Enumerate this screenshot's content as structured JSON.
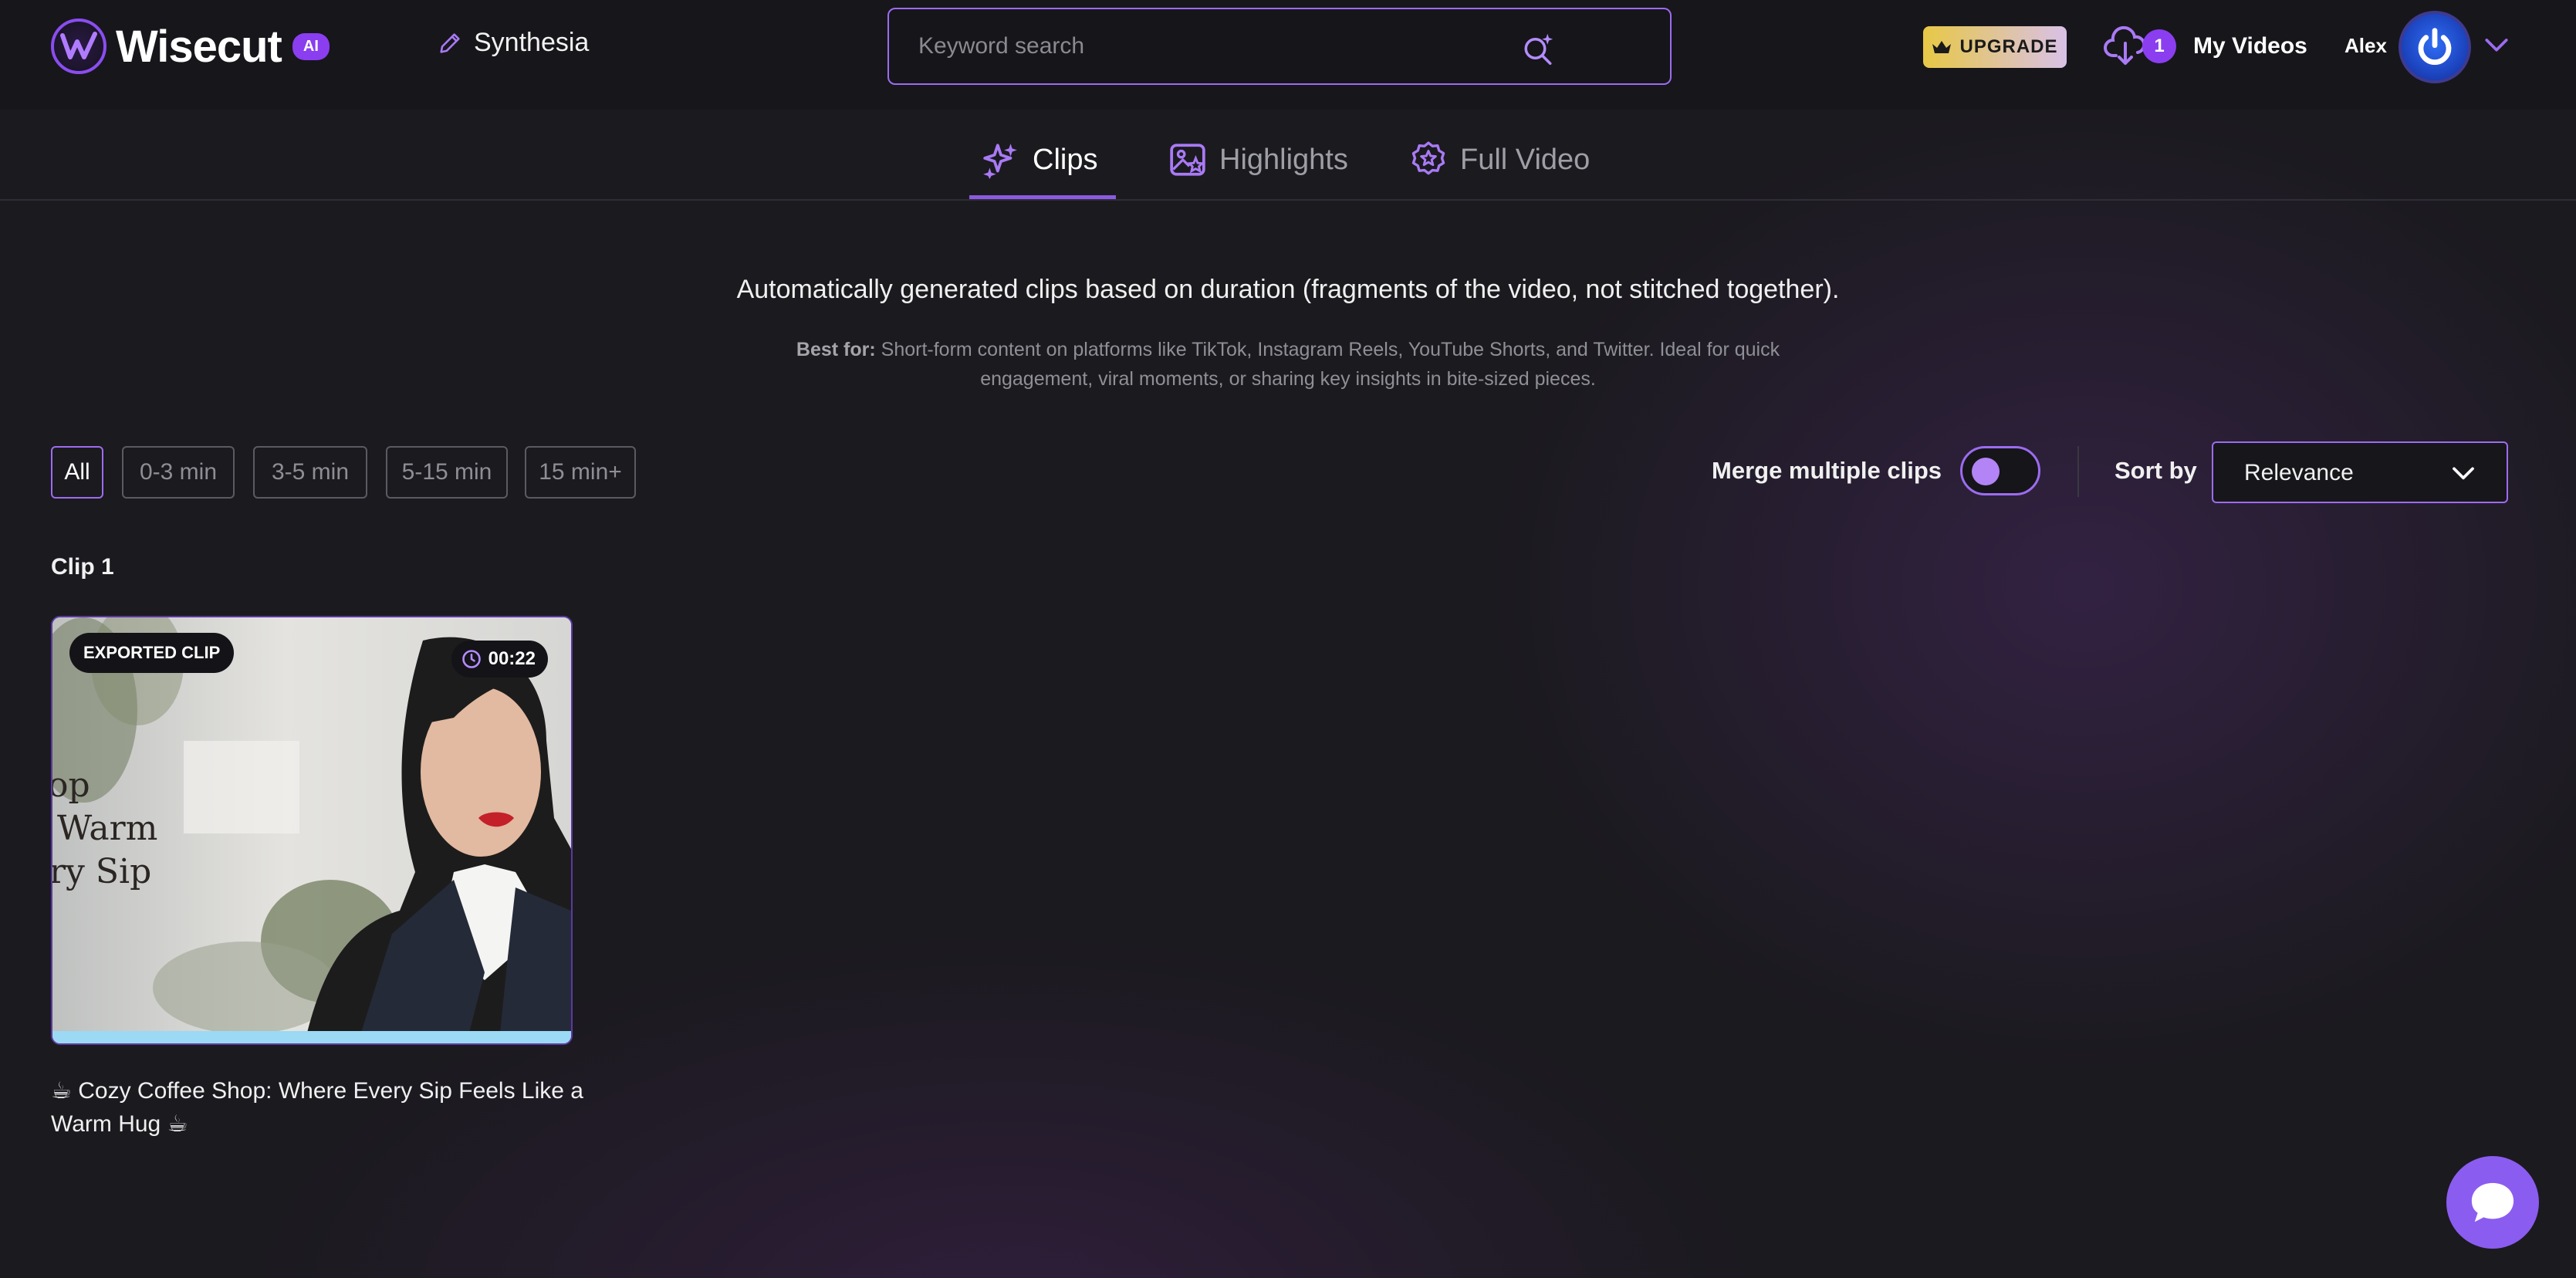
{
  "app": {
    "name": "Wisecut",
    "badge": "AI",
    "project_name": "Synthesia"
  },
  "search": {
    "placeholder": "Keyword search",
    "value": ""
  },
  "header": {
    "upgrade_label": "UPGRADE",
    "downloads_count": "1",
    "my_videos_label": "My Videos",
    "user_name": "Alex"
  },
  "tabs": [
    {
      "label": "Clips",
      "icon": "sparkles-icon",
      "active": true
    },
    {
      "label": "Highlights",
      "icon": "image-star-icon",
      "active": false
    },
    {
      "label": "Full Video",
      "icon": "badge-star-icon",
      "active": false
    }
  ],
  "description": {
    "main": "Automatically generated clips based on duration (fragments of the video, not stitched together).",
    "best_for_label": "Best for:",
    "best_for_text": "Short-form content on platforms like TikTok, Instagram Reels, YouTube Shorts, and Twitter. Ideal for quick engagement, viral moments, or sharing key insights in bite-sized pieces."
  },
  "filters": [
    {
      "label": "All",
      "active": true
    },
    {
      "label": "0-3 min",
      "active": false
    },
    {
      "label": "3-5 min",
      "active": false
    },
    {
      "label": "5-15 min",
      "active": false
    },
    {
      "label": "15 min+",
      "active": false
    }
  ],
  "controls": {
    "merge_label": "Merge multiple clips",
    "merge_enabled": false,
    "sort_label": "Sort by",
    "sort_value": "Relevance"
  },
  "clips": [
    {
      "heading": "Clip 1",
      "status_badge": "EXPORTED CLIP",
      "duration": "00:22",
      "thumbnail_overlay_text": [
        "op",
        "Warm",
        "ry Sip"
      ],
      "title": "☕ Cozy Coffee Shop: Where Every Sip Feels Like a Warm Hug ☕",
      "progress_fraction": 1.0
    }
  ],
  "colors": {
    "accent": "#9c6cf0",
    "badge_purple": "#8a3ef0",
    "background": "#1b1a1f",
    "progress": "#9bd9f4",
    "upgrade_gold": "#e7c845"
  }
}
